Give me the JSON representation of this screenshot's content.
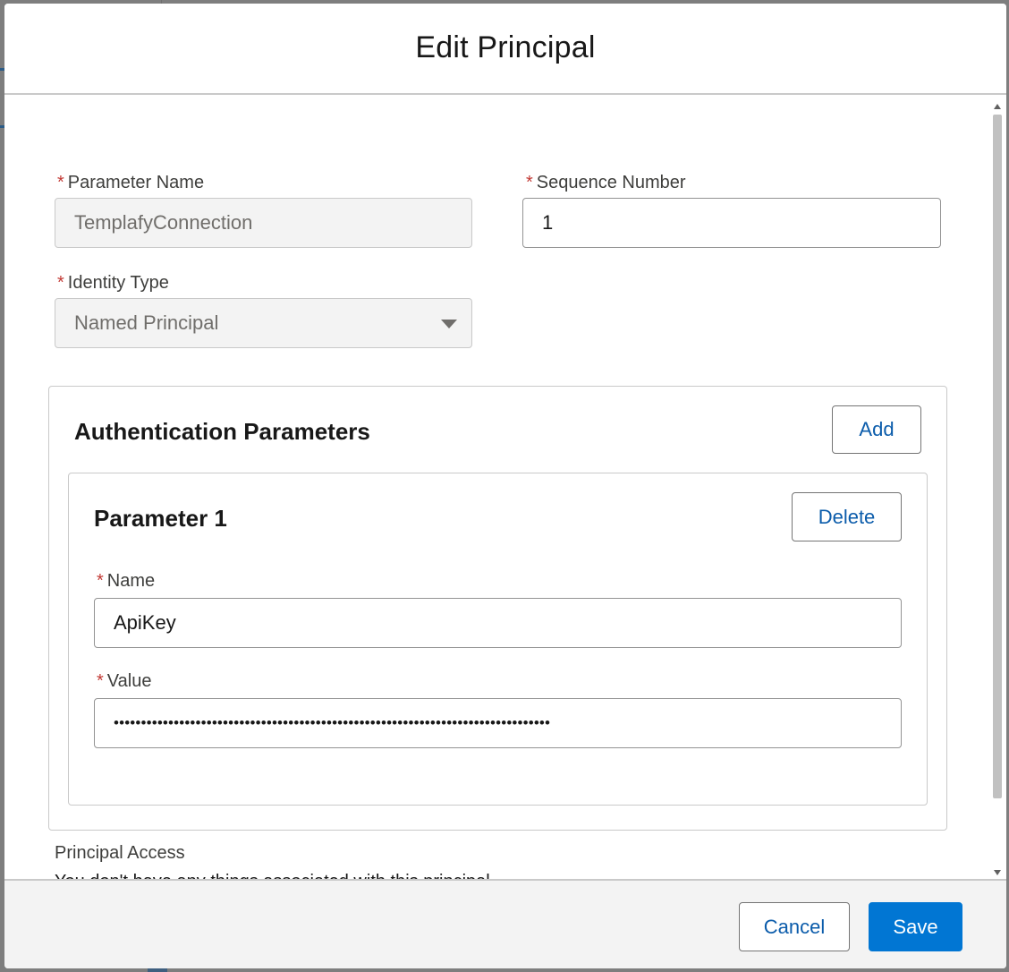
{
  "modal": {
    "title": "Edit Principal"
  },
  "form": {
    "required_marker": "*",
    "parameter_name": {
      "label": "Parameter Name",
      "value": "TemplafyConnection"
    },
    "sequence_number": {
      "label": "Sequence Number",
      "value": "1"
    },
    "identity_type": {
      "label": "Identity Type",
      "value": "Named Principal"
    }
  },
  "auth_params": {
    "title": "Authentication Parameters",
    "add_label": "Add",
    "items": [
      {
        "title": "Parameter 1",
        "delete_label": "Delete",
        "name_label": "Name",
        "name_value": "ApiKey",
        "value_label": "Value",
        "value_masked": "••••••••••••••••••••••••••••••••••••••••••••••••••••••••••••••••••••••••••••••••"
      }
    ]
  },
  "principal_access": {
    "label": "Principal Access",
    "partial_text": "You don't have any things associated with this principal."
  },
  "footer": {
    "cancel_label": "Cancel",
    "save_label": "Save"
  },
  "colors": {
    "brand": "#0176d3",
    "link": "#0b5cab",
    "required": "#c23934"
  },
  "icons": {
    "select_caret": "chevron-down-icon",
    "scroll_up": "scroll-up-arrow-icon",
    "scroll_down": "scroll-down-arrow-icon"
  }
}
